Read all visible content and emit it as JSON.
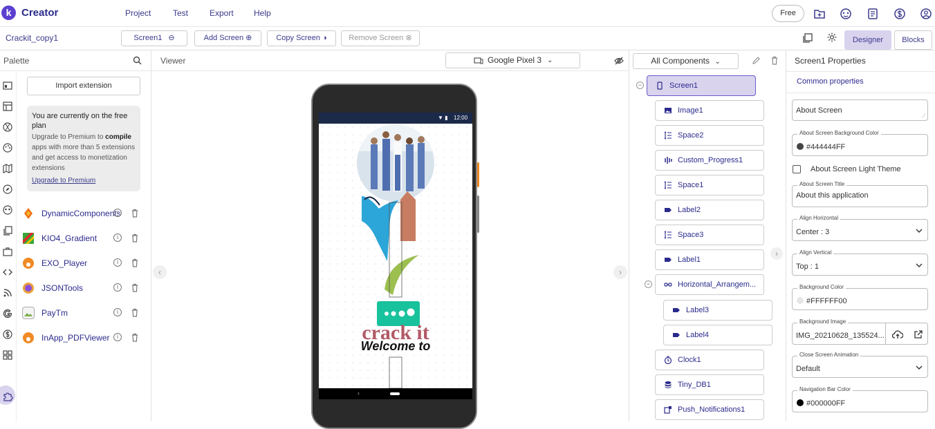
{
  "app": {
    "logo_letter": "k",
    "title": "Creator"
  },
  "menu": [
    "Project",
    "Test",
    "Export",
    "Help"
  ],
  "plan_pill": "Free",
  "toolbar": {
    "project_name": "Crackit_copy1",
    "screen_select": "Screen1",
    "add_screen": "Add Screen",
    "copy_screen": "Copy Screen",
    "remove_screen": "Remove Screen",
    "designer": "Designer",
    "blocks": "Blocks"
  },
  "palette": {
    "title": "Palette",
    "import_extension": "Import extension",
    "promo": {
      "heading": "You are currently on the free plan",
      "body_prefix": "Upgrade to Premium to ",
      "body_bold": "compile",
      "body_suffix": " apps with more than 5 extensions and get access to monetization extensions",
      "link": "Upgrade to Premium"
    },
    "extensions": [
      {
        "name": "DynamicComponents",
        "color": "#f2700f"
      },
      {
        "name": "KIO4_Gradient",
        "color": "#3aa53a"
      },
      {
        "name": "EXO_Player",
        "color": "#f08a24"
      },
      {
        "name": "JSONTools",
        "color": "#e9a23b"
      },
      {
        "name": "PayTm",
        "color": "#cfcfcf"
      },
      {
        "name": "InApp_PDFViewer",
        "color": "#f08a24"
      }
    ],
    "side_icons": [
      "layout-icon",
      "table-icon",
      "media-icon",
      "palette-icon",
      "map-icon",
      "compass-icon",
      "sensor-icon",
      "copy-icon",
      "briefcase-icon",
      "code-icon",
      "rss-icon",
      "google-icon",
      "dollar-icon",
      "grid-icon",
      "puzzle-icon"
    ]
  },
  "viewer": {
    "title": "Viewer",
    "device": "Google Pixel 3",
    "status_time": "12:00",
    "logo_text": "crack it",
    "welcome_text": "Welcome to"
  },
  "components": {
    "filter": "All Components",
    "tree": [
      {
        "name": "Screen1",
        "icon": "phone-icon",
        "level": 0,
        "selected": true
      },
      {
        "name": "Image1",
        "icon": "image-icon",
        "level": 1
      },
      {
        "name": "Space2",
        "icon": "space-icon",
        "level": 1
      },
      {
        "name": "Custom_Progress1",
        "icon": "progress-icon",
        "level": 1
      },
      {
        "name": "Space1",
        "icon": "space-icon",
        "level": 1
      },
      {
        "name": "Label2",
        "icon": "label-icon",
        "level": 1
      },
      {
        "name": "Space3",
        "icon": "space-icon",
        "level": 1
      },
      {
        "name": "Label1",
        "icon": "label-icon",
        "level": 1
      },
      {
        "name": "Horizontal_Arrangem...",
        "icon": "arrangement-icon",
        "level": 1
      },
      {
        "name": "Label3",
        "icon": "label-icon",
        "level": 2
      },
      {
        "name": "Label4",
        "icon": "label-icon",
        "level": 2
      },
      {
        "name": "Clock1",
        "icon": "clock-icon",
        "level": 1
      },
      {
        "name": "Tiny_DB1",
        "icon": "database-icon",
        "level": 1
      },
      {
        "name": "Push_Notifications1",
        "icon": "notification-icon",
        "level": 1
      }
    ]
  },
  "properties": {
    "title": "Screen1 Properties",
    "tab": "Common properties",
    "about_screen": "About Screen",
    "about_bg_label": "About Screen Background Color",
    "about_bg_value": "#444444FF",
    "light_theme": "About Screen Light Theme",
    "about_title_label": "About Screen Title",
    "about_title_value": "About this application",
    "align_h_label": "Align Horizontal",
    "align_h_value": "Center : 3",
    "align_v_label": "Align Vertical",
    "align_v_value": "Top : 1",
    "bg_color_label": "Background Color",
    "bg_color_value": "#FFFFFF00",
    "bg_image_label": "Background Image",
    "bg_image_value": "IMG_20210628_135524...",
    "close_anim_label": "Close Screen Animation",
    "close_anim_value": "Default",
    "nav_bar_label": "Navigation Bar Color",
    "nav_bar_value": "#000000FF"
  },
  "colors": {
    "accent": "#3a3a8c",
    "selected": "#d9d3ee",
    "about_bg_swatch": "#444444",
    "bg_swatch": "#e6e6e6",
    "nav_swatch": "#000000"
  }
}
